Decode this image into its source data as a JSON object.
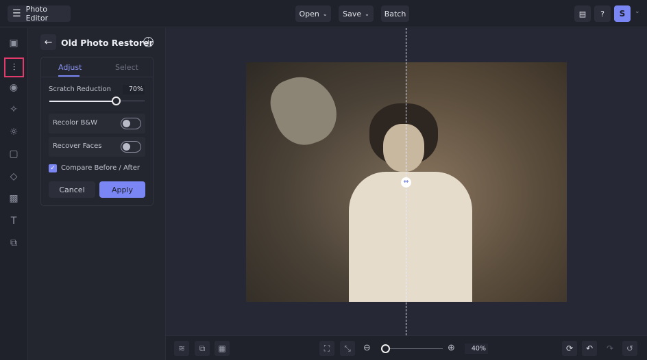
{
  "header": {
    "app_title": "Photo Editor",
    "open_label": "Open",
    "save_label": "Save",
    "batch_label": "Batch",
    "avatar_initial": "S"
  },
  "panel": {
    "title": "Old Photo Restorer",
    "tabs": [
      "Adjust",
      "Select"
    ],
    "active_tab": "Adjust",
    "scratch_label": "Scratch Reduction",
    "scratch_value": "70%",
    "scratch_fraction": 0.7,
    "recolor_label": "Recolor B&W",
    "recolor_on": false,
    "faces_label": "Recover Faces",
    "faces_on": false,
    "compare_label": "Compare Before / After",
    "compare_checked": true,
    "cancel_label": "Cancel",
    "apply_label": "Apply"
  },
  "zoom": {
    "value": "40%"
  },
  "colors": {
    "accent": "#7b86f5",
    "highlight": "#e23a6a"
  }
}
